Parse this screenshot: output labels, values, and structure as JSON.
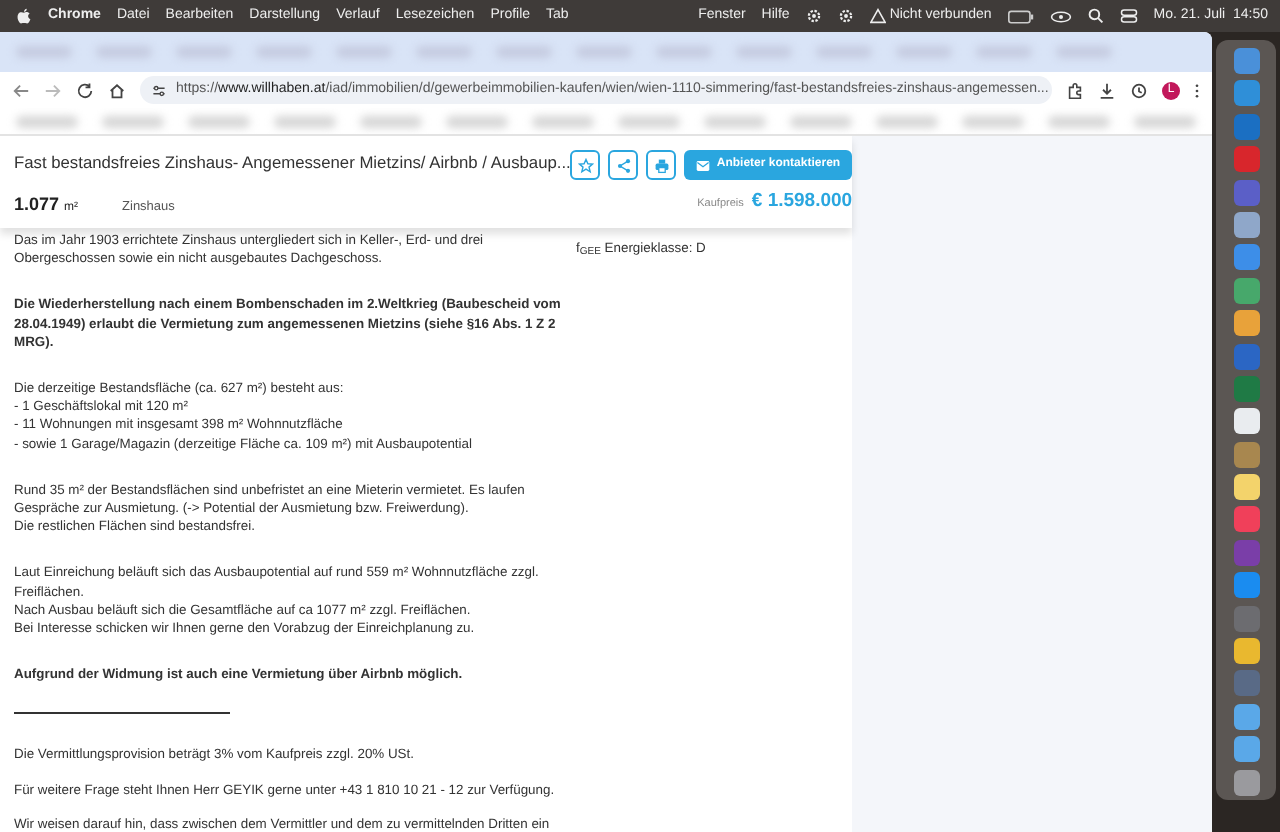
{
  "menubar": {
    "app": "Chrome",
    "menus": [
      "Datei",
      "Bearbeiten",
      "Darstellung",
      "Verlauf",
      "Lesezeichen",
      "Profile",
      "Tab"
    ],
    "right_menus": [
      "Fenster",
      "Hilfe"
    ],
    "network": "Nicht verbunden",
    "date": "Mo. 21. Juli",
    "time": "14:50"
  },
  "browser": {
    "url": "https://**www.willhaben.at**/iad/immobilien/d/gewerbeimmobilien-kaufen/wien/wien-1110-simmering/fast-bestandsfreies-zinshaus-angemessen...",
    "profile_initial": "L"
  },
  "listing": {
    "title": "Fast bestandsfreies Zinshaus- Angemessener Mietzins/ Airbnb / Ausbaup...",
    "area": "1.077",
    "area_unit": "m²",
    "type": "Zinshaus",
    "contact_button": "Anbieter kontaktieren",
    "price_label": "Kaufpreis",
    "price": "€ 1.598.000"
  },
  "description": [
    {
      "kind": "text",
      "text": "Das im Jahr 1903 errichtete Zinshaus untergliedert sich in Keller-, Erd- und drei\nObergeschossen sowie ein nicht ausgebautes Dachgeschoss."
    },
    {
      "kind": "bold",
      "text": "Die Wiederherstellung nach einem Bombenschaden im 2.Weltkrieg (Baubescheid vom\n28.04.1949)  erlaubt die Vermietung zum angemessenen Mietzins (siehe §16 Abs. 1 Z  2\nMRG)."
    },
    {
      "kind": "text",
      "text": "Die derzeitige Bestandsfläche (ca. 627 m²) besteht aus:\n- 1 Geschäftslokal mit 120 m²\n- 11 Wohnungen mit insgesamt 398 m² Wohnnutzfläche\n- sowie 1 Garage/Magazin (derzeitige Fläche ca. 109 m²) mit Ausbaupotential"
    },
    {
      "kind": "text",
      "text": "Rund 35 m² der Bestandsflächen sind unbefristet an eine Mieterin vermietet. Es laufen\nGespräche zur Ausmietung. (-> Potential der Ausmietung bzw. Freiwerdung).\nDie restlichen Flächen sind bestandsfrei."
    },
    {
      "kind": "text",
      "text": "Laut Einreichung beläuft sich das Ausbaupotential auf rund 559 m² Wohnnutzfläche zzgl.\nFreiflächen.\nNach Ausbau beläuft sich die Gesamtfläche auf ca 1077 m² zzgl. Freiflächen.\nBei Interesse schicken wir Ihnen gerne den Vorabzug der Einreichplanung zu."
    },
    {
      "kind": "bold",
      "text": "Aufgrund der Widmung ist auch eine Vermietung über Airbnb möglich."
    },
    {
      "kind": "rule"
    },
    {
      "kind": "text",
      "text": "Die Vermittlungsprovision beträgt 3% vom Kaufpreis zzgl. 20% USt."
    },
    {
      "kind": "text",
      "text": "Für weitere Frage steht Ihnen Herr GEYIK gerne unter +43 1 810 10 21 - 12 zur Verfügung."
    },
    {
      "kind": "text",
      "text": "Wir weisen darauf hin, dass zwischen dem Vermittler und dem zu vermittelnden Dritten ein"
    }
  ],
  "energy": "f$_{GEE}$ Energieklasse: D",
  "dock": {
    "apps": [
      {
        "color": "#4a90d9"
      },
      {
        "color": "#2f8fd8"
      },
      {
        "color": "#1b6fc2"
      },
      {
        "color": "#d8262c"
      },
      {
        "color": "#5b5fc7"
      },
      {
        "color": "#8fa7c9"
      },
      {
        "color": "#3d8ee8"
      },
      {
        "color": "#47a86b"
      },
      {
        "color": "#e8a23a"
      },
      {
        "color": "#2b66c4"
      },
      {
        "color": "#1f7a45"
      },
      {
        "color": "#e9ecef"
      },
      {
        "color": "#a8874f"
      },
      {
        "color": "#f3d36b"
      },
      {
        "color": "#f0405a"
      },
      {
        "color": "#7a3ea8"
      },
      {
        "color": "#1a8cf0"
      },
      {
        "color": "#6c6c70"
      },
      {
        "color": "#e9b82f"
      },
      {
        "color": "#596a86"
      },
      {
        "color": "#5aa8e8"
      },
      {
        "color": "#5aa8e8"
      },
      {
        "color": "#9a9a9e"
      }
    ]
  }
}
